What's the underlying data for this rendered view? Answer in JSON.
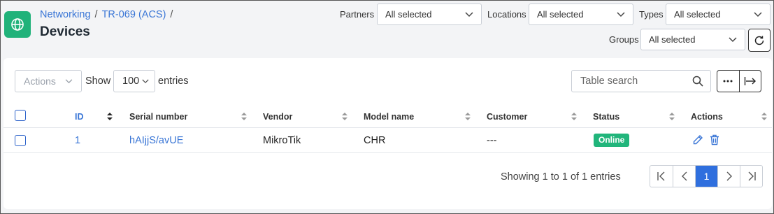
{
  "header": {
    "breadcrumb": [
      "Networking",
      "TR-069 (ACS)"
    ],
    "separator": "/",
    "title": "Devices"
  },
  "filters": {
    "partners": {
      "label": "Partners",
      "value": "All selected"
    },
    "locations": {
      "label": "Locations",
      "value": "All selected"
    },
    "types": {
      "label": "Types",
      "value": "All selected"
    },
    "groups": {
      "label": "Groups",
      "value": "All selected"
    }
  },
  "toolbar": {
    "actions_label": "Actions",
    "show_label": "Show",
    "entries_value": "100",
    "entries_label": "entries",
    "search_placeholder": "Table search"
  },
  "table": {
    "columns": [
      "ID",
      "Serial number",
      "Vendor",
      "Model name",
      "Customer",
      "Status",
      "Actions"
    ],
    "rows": [
      {
        "id": "1",
        "serial": "hAIjjS/avUE",
        "vendor": "MikroTik",
        "model": "CHR",
        "customer": "---",
        "status": "Online"
      }
    ]
  },
  "footer": {
    "info": "Showing 1 to 1 of 1 entries",
    "current_page": "1"
  },
  "colors": {
    "accent": "#3a76d6",
    "status_online": "#21b57b",
    "app_icon": "#20b27a"
  }
}
